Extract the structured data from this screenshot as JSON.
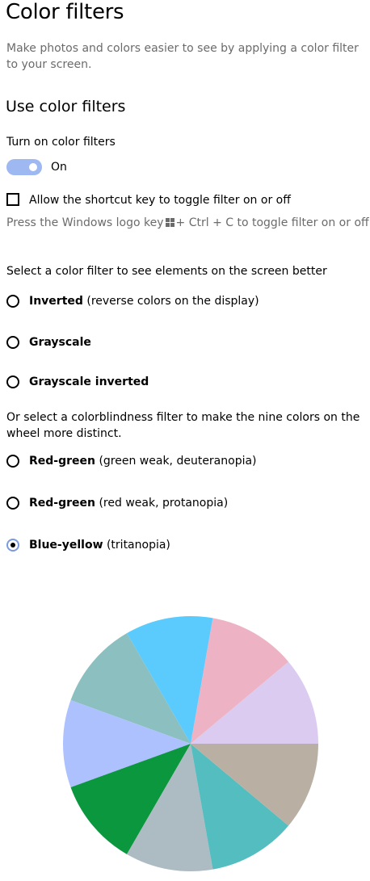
{
  "page": {
    "title": "Color filters",
    "description": "Make photos and colors easier to see by applying a color filter to your screen."
  },
  "use_color_filters": {
    "section_title": "Use color filters",
    "toggle_label": "Turn on color filters",
    "toggle_state": "On",
    "toggle_on": true,
    "toggle_color": "#9eb8f2"
  },
  "shortcut": {
    "checkbox_label": "Allow the shortcut key to toggle filter on or off",
    "checked": false,
    "hint_before_icon": "Press the Windows logo key",
    "hint_icon": "windows-logo-icon",
    "hint_after_icon": "+ Ctrl + C to toggle filter on or off."
  },
  "filters": {
    "prompt": "Select a color filter to see elements on the screen better",
    "options": [
      {
        "name": "Inverted",
        "detail": "(reverse colors on the display)",
        "selected": false
      },
      {
        "name": "Grayscale",
        "detail": "",
        "selected": false
      },
      {
        "name": "Grayscale inverted",
        "detail": "",
        "selected": false
      }
    ]
  },
  "colorblind": {
    "prompt": "Or select a colorblindness filter to make the nine colors on the wheel more distinct.",
    "options": [
      {
        "name": "Red-green",
        "detail": "(green weak, deuteranopia)",
        "selected": false
      },
      {
        "name": "Red-green",
        "detail": "(red weak, protanopia)",
        "selected": false
      },
      {
        "name": "Blue-yellow",
        "detail": "(tritanopia)",
        "selected": true
      }
    ]
  },
  "color_wheel": {
    "segment_colors": [
      "#dbcbf1",
      "#edb3c4",
      "#5bcbfe",
      "#8cbfbf",
      "#adc1ff",
      "#0a973d",
      "#adbbc2",
      "#53bdbf",
      "#b9b0a3"
    ]
  }
}
